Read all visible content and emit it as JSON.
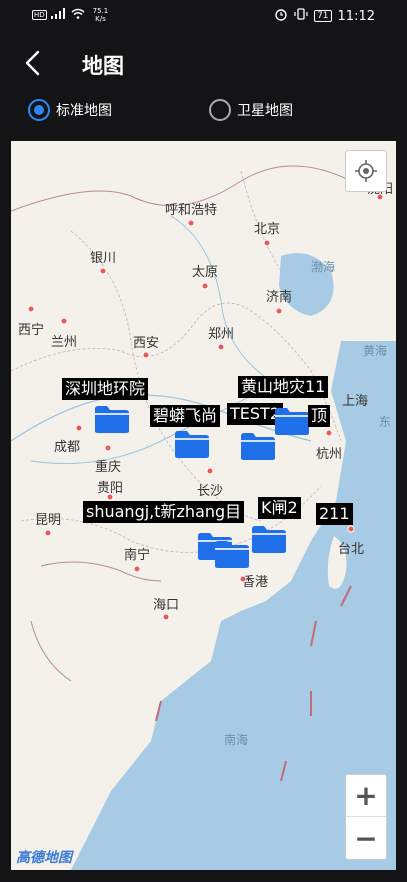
{
  "status": {
    "speed": "75.1",
    "speed_unit": "K/s",
    "battery": "71",
    "time": "11:12"
  },
  "header": {
    "title": "地图"
  },
  "map_type": {
    "options": [
      {
        "label": "标准地图",
        "checked": true
      },
      {
        "label": "卫星地图",
        "checked": false
      }
    ]
  },
  "map": {
    "cities": [
      "沈阳",
      "呼和浩特",
      "北京",
      "银川",
      "太原",
      "渤海",
      "济南",
      "西宁",
      "兰州",
      "西安",
      "郑州",
      "黄海",
      "成都",
      "重庆",
      "贵阳",
      "长沙",
      "杭州",
      "昆明",
      "南宁",
      "香港",
      "台北",
      "海口",
      "南海",
      "上海",
      "东"
    ],
    "markers": [
      {
        "label": "深圳地环院"
      },
      {
        "label": "碧蟒飞尚"
      },
      {
        "label": "TEST2"
      },
      {
        "label": "黄山地灾11"
      },
      {
        "label": "顶"
      },
      {
        "label": "shuangj,t新zhang目"
      },
      {
        "label": "K闸2"
      },
      {
        "label": "211"
      }
    ],
    "logo": "高德地图",
    "zoom_in": "+",
    "zoom_out": "−"
  },
  "colors": {
    "accent": "#2f86f6",
    "marker": "#1f6fe8"
  }
}
